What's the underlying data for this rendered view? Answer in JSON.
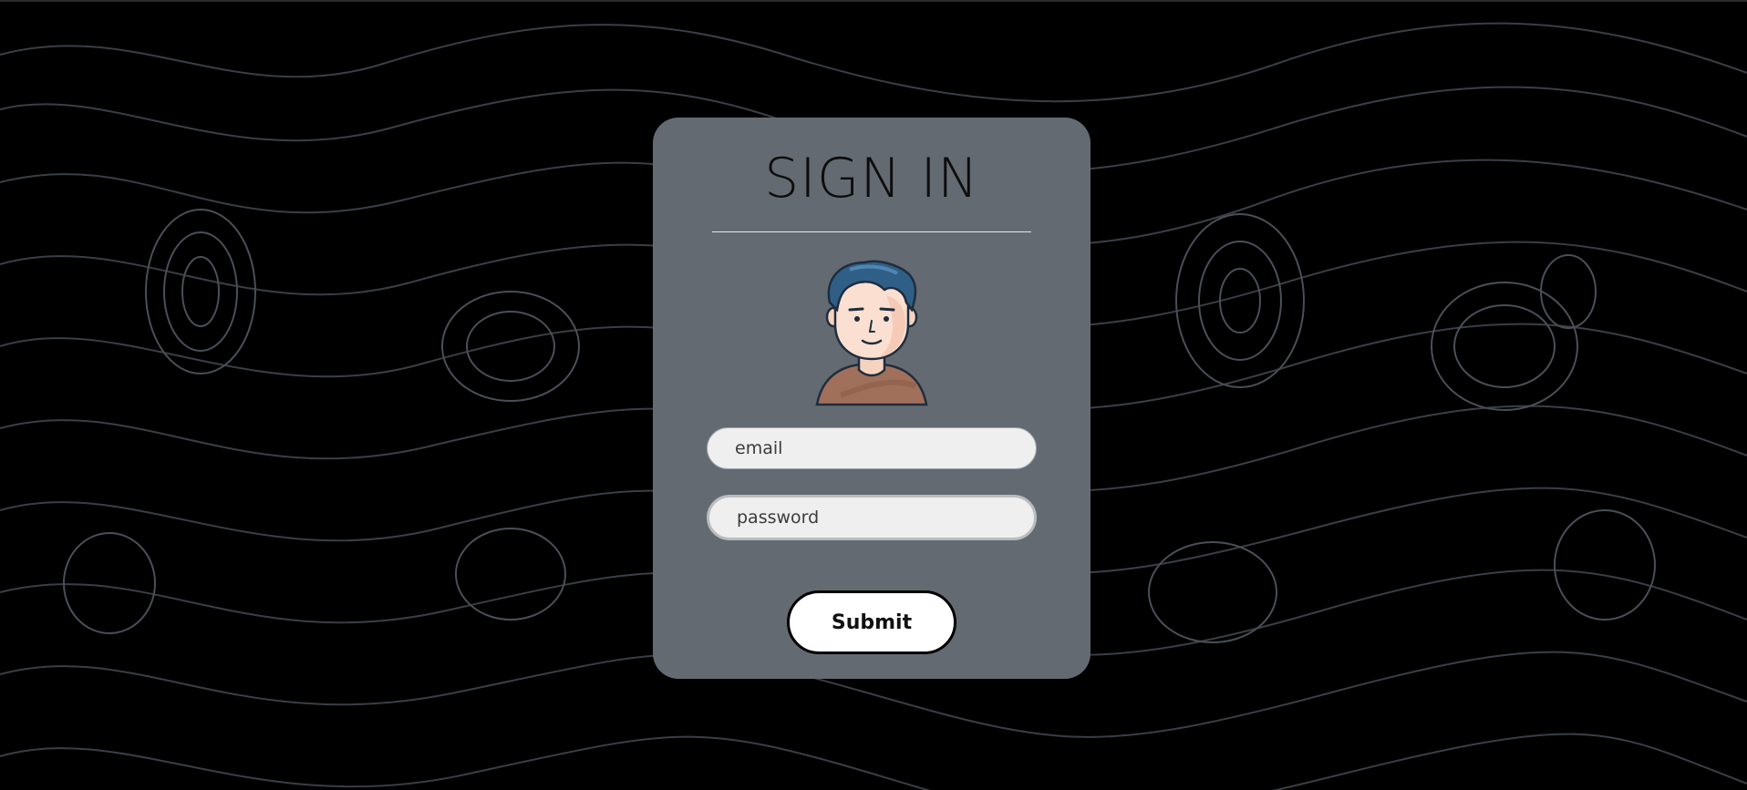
{
  "page": {
    "title": "SIGN IN"
  },
  "form": {
    "email_placeholder": "email",
    "password_placeholder": "password",
    "submit_label": "Submit"
  },
  "colors": {
    "background": "#000000",
    "card": "#646a71",
    "contour_lines": "#3a3e45"
  },
  "icons": {
    "avatar": "user-avatar-illustration"
  }
}
